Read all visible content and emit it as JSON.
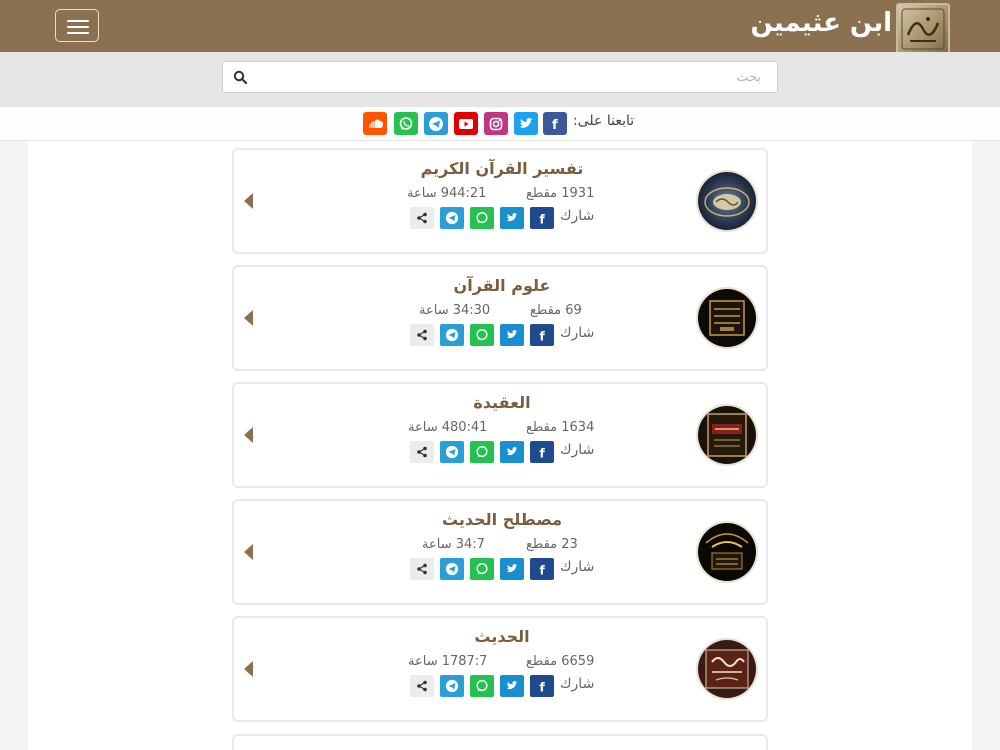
{
  "header": {
    "title": "ابن عثيمين"
  },
  "search": {
    "placeholder": "بحث"
  },
  "follow": {
    "label": "تابعنا على:",
    "networks": [
      {
        "name": "facebook",
        "color": "#3b5998"
      },
      {
        "name": "twitter",
        "color": "#1da1f2"
      },
      {
        "name": "instagram",
        "color": "#c13584"
      },
      {
        "name": "youtube",
        "color": "#e00000"
      },
      {
        "name": "telegram",
        "color": "#2a9fd6"
      },
      {
        "name": "whatsapp",
        "color": "#25c151"
      },
      {
        "name": "soundcloud",
        "color": "#ff5500"
      }
    ]
  },
  "share": {
    "label": "شارك"
  },
  "categories": [
    {
      "title": "تفسير القرآن الكريم",
      "clips": "1931 مقطع",
      "hours": "944:21 ساعة"
    },
    {
      "title": "علوم القرآن",
      "clips": "69 مقطع",
      "hours": "34:30 ساعة"
    },
    {
      "title": "العقيدة",
      "clips": "1634 مقطع",
      "hours": "480:41 ساعة"
    },
    {
      "title": "مصطلح الحديث",
      "clips": "23 مقطع",
      "hours": "34:7 ساعة"
    },
    {
      "title": "الحديث",
      "clips": "6659 مقطع",
      "hours": "1787:7 ساعة"
    }
  ],
  "colors": {
    "brand": "#8c7150",
    "title": "#7a5e3d",
    "facebook": "#1f4b8e",
    "twitter": "#1a8fd0",
    "whatsapp": "#25c151",
    "telegram": "#2a9fd6",
    "share": "#ececec"
  }
}
